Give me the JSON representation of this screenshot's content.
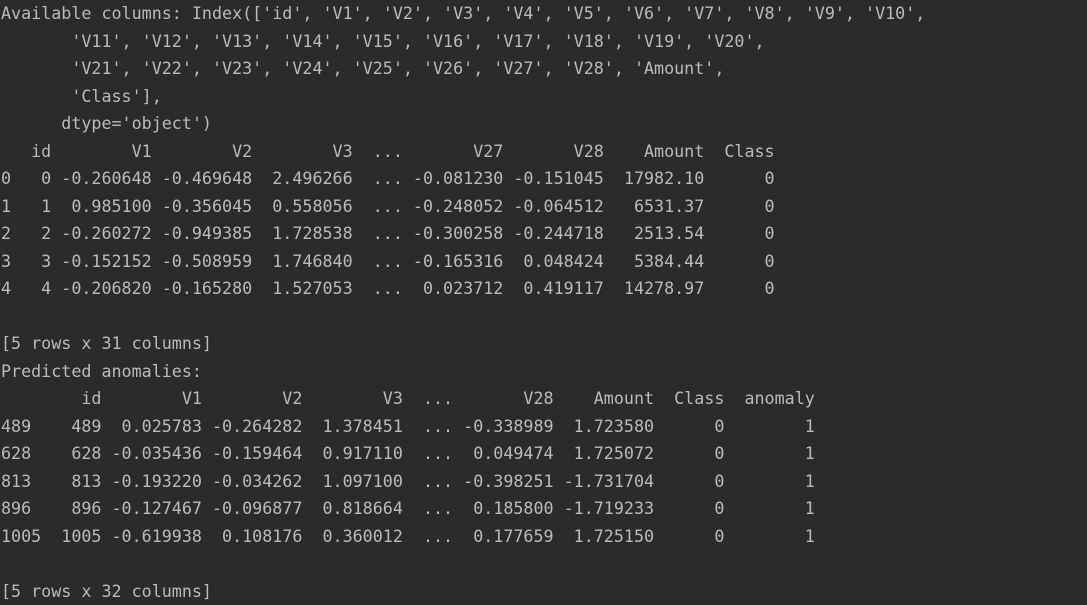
{
  "console": {
    "background": "#2b2b2b",
    "text_color": "#bbbbbb",
    "lines": [
      "Available columns: Index(['id', 'V1', 'V2', 'V3', 'V4', 'V5', 'V6', 'V7', 'V8', 'V9', 'V10',",
      "       'V11', 'V12', 'V13', 'V14', 'V15', 'V16', 'V17', 'V18', 'V19', 'V20',",
      "       'V21', 'V22', 'V23', 'V24', 'V25', 'V26', 'V27', 'V28', 'Amount',",
      "       'Class'],",
      "      dtype='object')",
      "   id        V1        V2        V3  ...       V27       V28    Amount  Class",
      "0   0 -0.260648 -0.469648  2.496266  ... -0.081230 -0.151045  17982.10      0",
      "1   1  0.985100 -0.356045  0.558056  ... -0.248052 -0.064512   6531.37      0",
      "2   2 -0.260272 -0.949385  1.728538  ... -0.300258 -0.244718   2513.54      0",
      "3   3 -0.152152 -0.508959  1.746840  ... -0.165316  0.048424   5384.44      0",
      "4   4 -0.206820 -0.165280  1.527053  ...  0.023712  0.419117  14278.97      0",
      "",
      "[5 rows x 31 columns]",
      "Predicted anomalies:",
      "        id        V1        V2        V3  ...       V28    Amount  Class  anomaly",
      "489    489  0.025783 -0.264282  1.378451  ... -0.338989  1.723580      0        1",
      "628    628 -0.035436 -0.159464  0.917110  ...  0.049474  1.725072      0        1",
      "813    813 -0.193220 -0.034262  1.097100  ... -0.398251 -1.731704      0        1",
      "896    896 -0.127467 -0.096877  0.818664  ...  0.185800 -1.719233      0        1",
      "1005  1005 -0.619938  0.108176  0.360012  ...  0.177659  1.725150      0        1",
      "",
      "[5 rows x 32 columns]"
    ]
  }
}
